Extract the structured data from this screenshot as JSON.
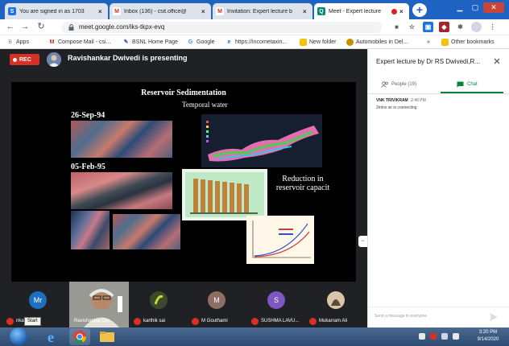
{
  "tabs": [
    {
      "title": "You are signed in as 1703",
      "icon": "signin-icon",
      "color": "#1a73e8",
      "glyph": "S"
    },
    {
      "title": "Inbox (136) - csit.office@",
      "icon": "gmail-icon",
      "color": "#d93025",
      "glyph": "M"
    },
    {
      "title": "Invitation: Expert lecture b",
      "icon": "gmail-icon",
      "color": "#d93025",
      "glyph": "M"
    },
    {
      "title": "Meet - Expert lecture",
      "icon": "meet-icon",
      "color": "#00897b",
      "glyph": "Q"
    }
  ],
  "new_tab_glyph": "+",
  "address": {
    "url": "meet.google.com/iks-tkpx-evq"
  },
  "bookmarks": [
    {
      "label": "Apps",
      "icon": "apps-grid-icon",
      "color": "#5f6368"
    },
    {
      "label": "Compose Mail - csi...",
      "icon": "gmail-icon",
      "color": "#d93025"
    },
    {
      "label": "BSNL Home Page",
      "icon": "bsnl-icon",
      "color": "#3b5bb5"
    },
    {
      "label": "Google",
      "icon": "google-icon",
      "color": "#4285f4"
    },
    {
      "label": "https://incometaxin...",
      "icon": "ie-icon",
      "color": "#1a73e8"
    },
    {
      "label": "New folder",
      "icon": "folder-icon",
      "color": "#f4c20d"
    },
    {
      "label": "Automobiles in Del...",
      "icon": "automobile-icon",
      "color": "#c49000"
    },
    {
      "label": "Other bookmarks",
      "icon": "folder-icon",
      "color": "#f4c20d"
    }
  ],
  "bookmarks_overflow": "»",
  "meeting": {
    "rec_label": "REC",
    "presenting_text": "Ravishankar Dwivedi is presenting"
  },
  "slide": {
    "title": "Reservoir Sedimentation",
    "subtitle": "Temporal water",
    "dates": [
      "26-Sep-94",
      "05-Feb-95"
    ],
    "note": "Reduction in reservoir capacit"
  },
  "participants": [
    {
      "initials": "Mr",
      "name": "nkatesh",
      "color": "#1e6fc0"
    },
    {
      "initials": "",
      "name": "Ravishankar Dw...",
      "color": "#9a9a94"
    },
    {
      "initials": "",
      "name": "karthik sai",
      "color": "#3a4a2a"
    },
    {
      "initials": "M",
      "name": "M Gouthami",
      "color": "#8d6e63"
    },
    {
      "initials": "S",
      "name": "SUSHMA LAVU...",
      "color": "#7e57c2"
    },
    {
      "initials": "",
      "name": "Mukarram Ali",
      "color": "#5d4a3a"
    }
  ],
  "start_tooltip": "Start",
  "panel": {
    "title": "Expert lecture by Dr RS Dwivedi,R...",
    "tabs": [
      {
        "label": "People (19)",
        "icon": "people-icon"
      },
      {
        "label": "Chat",
        "icon": "chat-icon"
      }
    ],
    "message": {
      "sender": "VNK TRIVIKRAM",
      "time": "2:40 PM",
      "text": "2mins sir is connecting"
    },
    "input_placeholder": "Send a message to everyone"
  },
  "taskbar": {
    "time": "3:20 PM",
    "date": "9/14/2020"
  },
  "colors": {
    "tabstrip": "#1f63c2",
    "meet_bg": "#202124",
    "rec": "#d93025",
    "chat_accent": "#0b8043"
  }
}
